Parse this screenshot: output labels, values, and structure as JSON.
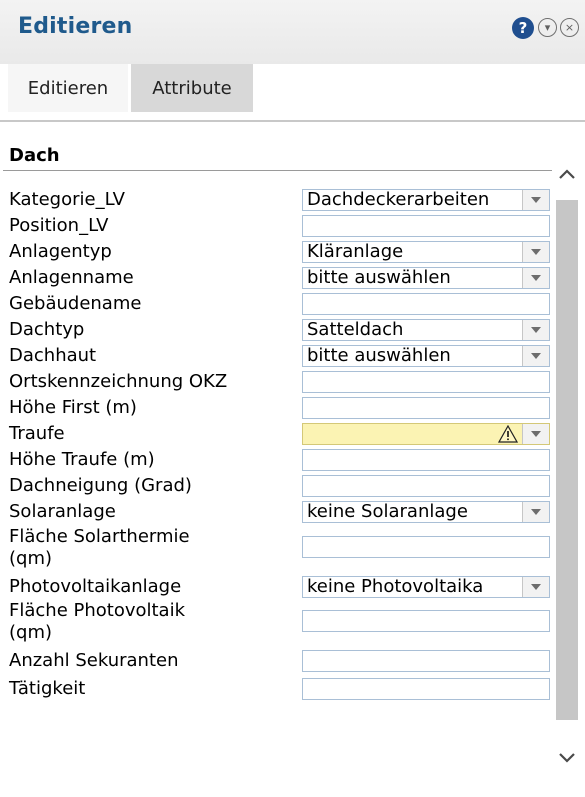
{
  "window": {
    "title": "Editieren",
    "help_icon": "?",
    "collapse_icon": "⊙",
    "close_icon": "⊗"
  },
  "tabs": [
    "Editieren",
    "Attribute"
  ],
  "section": {
    "title": "Dach"
  },
  "rows": [
    {
      "label": "Kategorie_LV",
      "type": "select",
      "value": "Dachdeckerarbeiten"
    },
    {
      "label": "Position_LV",
      "type": "text",
      "value": ""
    },
    {
      "label": "Anlagentyp",
      "type": "select",
      "value": "Kläranlage"
    },
    {
      "label": "Anlagenname",
      "type": "select",
      "value": "bitte auswählen"
    },
    {
      "label": "Gebäudename",
      "type": "text",
      "value": ""
    },
    {
      "label": "Dachtyp",
      "type": "select",
      "value": "Satteldach"
    },
    {
      "label": "Dachhaut",
      "type": "select",
      "value": "bitte auswählen"
    },
    {
      "label": "Ortskennzeichnung OKZ",
      "type": "text",
      "value": ""
    },
    {
      "label": "Höhe First (m)",
      "type": "text",
      "value": ""
    },
    {
      "label": "Traufe",
      "type": "select",
      "value": "",
      "warning": true
    },
    {
      "label": "Höhe Traufe (m)",
      "type": "text",
      "value": ""
    },
    {
      "label": "Dachneigung (Grad)",
      "type": "text",
      "value": ""
    },
    {
      "label": "Solaranlage",
      "type": "select",
      "value": "keine Solaranlage"
    },
    {
      "label": "Fläche Solarthermie",
      "label2": "(qm)",
      "type": "text",
      "value": ""
    },
    {
      "label": "Photovoltaikanlage",
      "type": "select",
      "value": "keine Photovoltaika"
    },
    {
      "label": "Fläche Photovoltaik",
      "label2": "(qm)",
      "type": "text",
      "value": ""
    },
    {
      "label": "Anzahl Sekuranten",
      "type": "text",
      "value": ""
    },
    {
      "label": "Tätigkeit",
      "type": "text",
      "value": ""
    }
  ],
  "scrollbar": {
    "up_icon": "chevron-up-icon",
    "down_icon": "chevron-down-icon"
  }
}
